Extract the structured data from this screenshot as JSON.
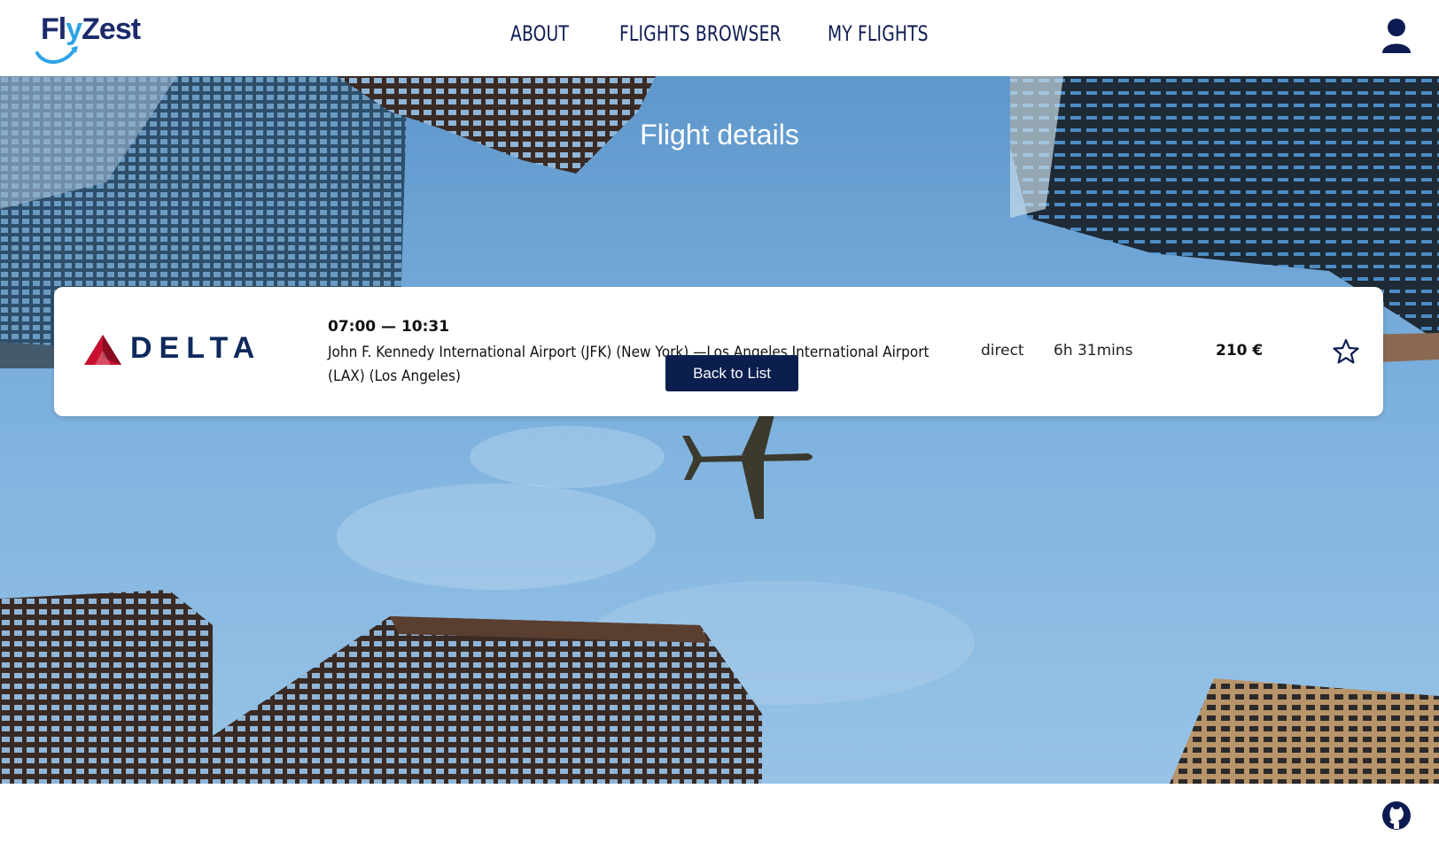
{
  "brand": {
    "name_part1": "Fl",
    "name_part2": "y",
    "name_part3": "Zest",
    "primary_color": "#1b2a6b",
    "accent_color": "#2ea3e3"
  },
  "nav": {
    "items": [
      {
        "label": "ABOUT"
      },
      {
        "label": "FLIGHTS BROWSER"
      },
      {
        "label": "MY FLIGHTS"
      }
    ],
    "user_icon": "user-icon"
  },
  "hero": {
    "title": "Flight details"
  },
  "flight": {
    "airline": "DELTA",
    "airline_logo_icon": "delta-widget-icon",
    "times": "07:00 — 10:31",
    "route": "John F. Kennedy International Airport (JFK) (New York) —Los Angeles International Airport (LAX) (Los Angeles)",
    "stops": "direct",
    "duration": "6h 31mins",
    "price": "210 €",
    "favorite_icon": "star-outline-icon"
  },
  "actions": {
    "back_label": "Back to List"
  },
  "footer": {
    "github_icon": "github-icon"
  },
  "colors": {
    "navy": "#0b1f4f",
    "sky": "#78addc",
    "delta_red": "#c8102e"
  }
}
